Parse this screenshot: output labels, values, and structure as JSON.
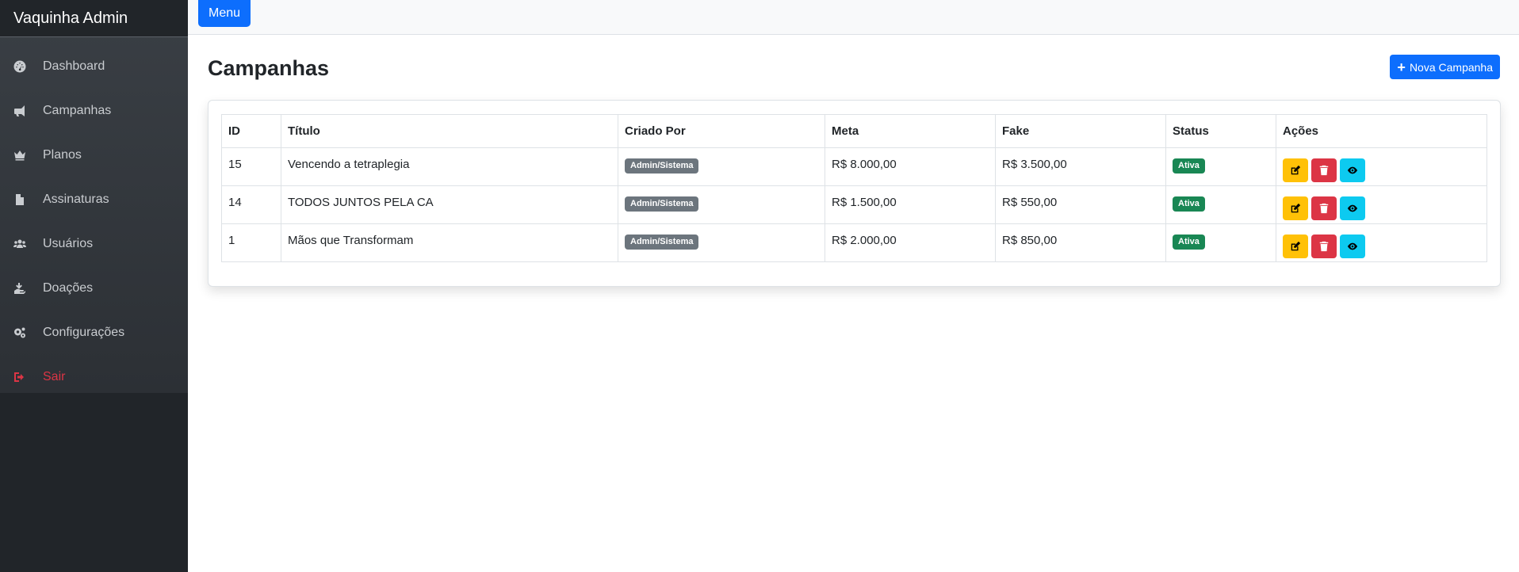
{
  "sidebar": {
    "brand": "Vaquinha Admin",
    "items": [
      {
        "label": "Dashboard",
        "icon": "gauge-icon"
      },
      {
        "label": "Campanhas",
        "icon": "megaphone-icon"
      },
      {
        "label": "Planos",
        "icon": "crown-icon"
      },
      {
        "label": "Assinaturas",
        "icon": "file-invoice-icon"
      },
      {
        "label": "Usuários",
        "icon": "users-icon"
      },
      {
        "label": "Doações",
        "icon": "hand-holding-icon"
      },
      {
        "label": "Configurações",
        "icon": "cogs-icon"
      },
      {
        "label": "Sair",
        "icon": "sign-out-icon"
      }
    ]
  },
  "topbar": {
    "menu_label": "Menu"
  },
  "main": {
    "title": "Campanhas",
    "new_button": "Nova Campanha",
    "table": {
      "headers": [
        "ID",
        "Título",
        "Criado Por",
        "Meta",
        "Fake",
        "Status",
        "Ações"
      ],
      "rows": [
        {
          "id": "15",
          "title": "Vencendo a tetraplegia",
          "created_by": "Admin/Sistema",
          "meta": "R$ 8.000,00",
          "fake": "R$ 3.500,00",
          "status": "Ativa"
        },
        {
          "id": "14",
          "title": "TODOS JUNTOS PELA CA",
          "created_by": "Admin/Sistema",
          "meta": "R$ 1.500,00",
          "fake": "R$ 550,00",
          "status": "Ativa"
        },
        {
          "id": "1",
          "title": "Mãos que Transformam",
          "created_by": "Admin/Sistema",
          "meta": "R$ 2.000,00",
          "fake": "R$ 850,00",
          "status": "Ativa"
        }
      ]
    }
  },
  "colors": {
    "primary": "#0d6efd",
    "warning": "#ffc107",
    "danger": "#dc3545",
    "info": "#0dcaf0",
    "success": "#198754",
    "secondary": "#6c757d",
    "sidebar": "#212529"
  }
}
